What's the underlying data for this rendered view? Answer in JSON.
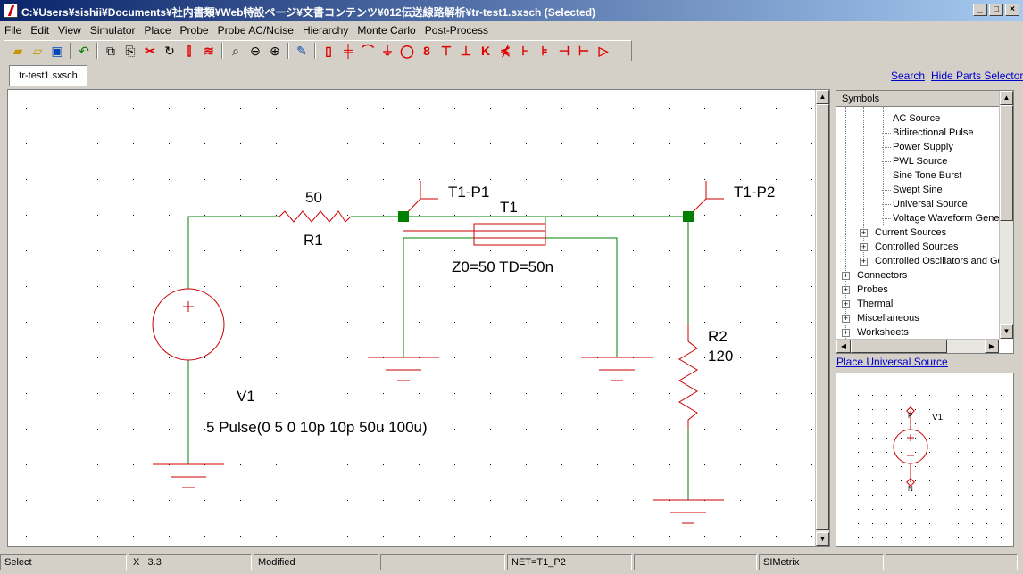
{
  "window": {
    "title": "C:¥Users¥sishii¥Documents¥社内書類¥Web特設ページ¥文書コンテンツ¥012伝送線路解析¥tr-test1.sxsch (Selected)",
    "buttons": {
      "minimize": "_",
      "maximize": "□",
      "close": "×"
    }
  },
  "menu": [
    {
      "label": "File"
    },
    {
      "label": "Edit"
    },
    {
      "label": "View"
    },
    {
      "label": "Simulator"
    },
    {
      "label": "Place"
    },
    {
      "label": "Probe"
    },
    {
      "label": "Probe AC/Noise"
    },
    {
      "label": "Hierarchy"
    },
    {
      "label": "Monte Carlo"
    },
    {
      "label": "Post-Process"
    }
  ],
  "toolbar": {
    "icons": [
      "open-folder-icon",
      "open-recent-icon",
      "save-icon",
      "sep",
      "undo-icon",
      "sep",
      "copy-icon",
      "paste-icon",
      "cut-icon",
      "rotate-icon",
      "mirror-icon",
      "flip-icon",
      "sep",
      "zoom-fit-icon",
      "zoom-out-icon",
      "zoom-in-icon",
      "sep",
      "pencil-wire-icon",
      "sep",
      "resistor-icon",
      "capacitor-icon",
      "inductor-icon",
      "ground-icon",
      "voltage-source-icon",
      "current-source-icon",
      "npn-icon",
      "pnp-icon",
      "nmos-icon",
      "pmos-icon",
      "diode-icon",
      "zener-icon",
      "probe-icon",
      "terminal-icon",
      "opamp-icon"
    ]
  },
  "tab": {
    "label": "tr-test1.sxsch"
  },
  "links": {
    "search": "Search",
    "hide_parts": "Hide Parts Selector"
  },
  "schematic": {
    "r1_value": "50",
    "r1_name": "R1",
    "t1_name": "T1",
    "t1_params": "Z0=50 TD=50n",
    "probe1": "T1-P1",
    "probe2": "T1-P2",
    "r2_name": "R2",
    "r2_value": "120",
    "v1_name": "V1",
    "v1_value": "5 Pulse(0 5 0 10p 10p 50u 100u)"
  },
  "symbols": {
    "header": "Symbols",
    "leaves": [
      "AC Source",
      "Bidirectional Pulse",
      "Power Supply",
      "PWL Source",
      "Sine Tone Burst",
      "Swept Sine",
      "Universal Source",
      "Voltage Waveform Gener"
    ],
    "sub_groups": [
      "Current Sources",
      "Controlled Sources",
      "Controlled Oscillators and Gen"
    ],
    "groups": [
      "Connectors",
      "Probes",
      "Thermal",
      "Miscellaneous",
      "Worksheets"
    ]
  },
  "place_link": "Place Universal Source",
  "preview": {
    "name": "V1",
    "pin_p": "P",
    "pin_n": "N"
  },
  "status": {
    "mode": "Select",
    "x_label": "X",
    "x_value": "3.3",
    "modified": "Modified",
    "net": "NET=T1_P2",
    "app": "SIMetrix"
  }
}
